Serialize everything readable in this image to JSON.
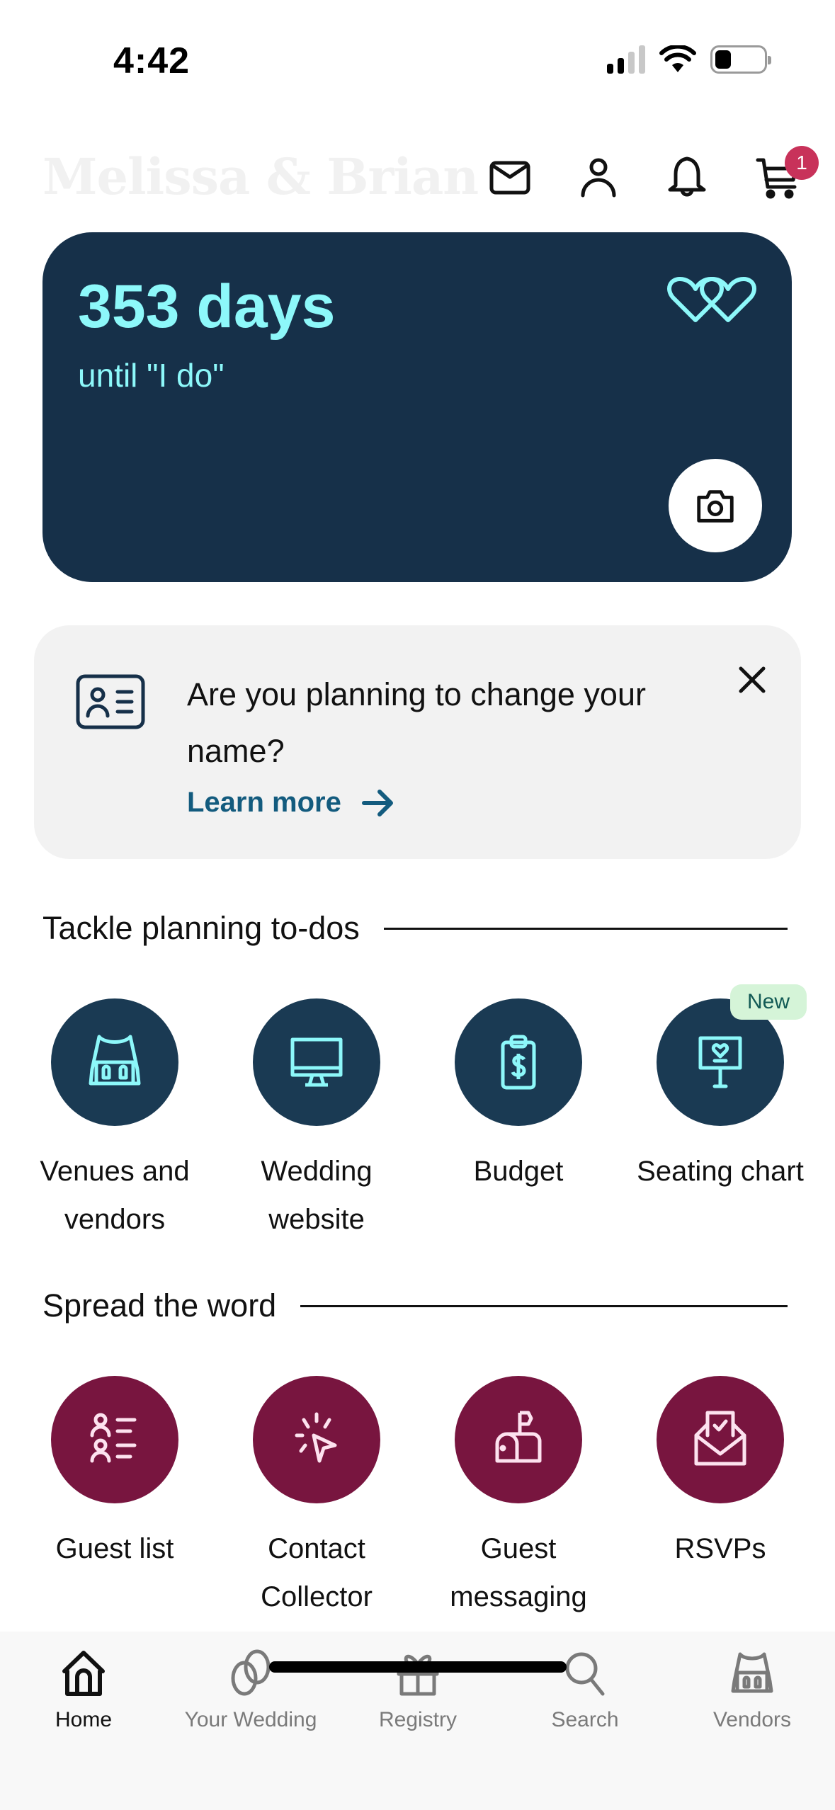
{
  "status_bar": {
    "time": "4:42",
    "signal_bars_active": 2,
    "signal_bars_total": 4,
    "battery_level": 0.25
  },
  "header": {
    "title": "Melissa & Brian",
    "icons": [
      "mail-icon",
      "profile-icon",
      "bell-icon",
      "cart-icon"
    ],
    "cart_badge_count": "1"
  },
  "countdown": {
    "days_text": "353 days",
    "subtitle": "until \"I do\"",
    "icon": "double-heart-icon",
    "camera_icon": "camera-icon"
  },
  "name_banner": {
    "icon": "id-card-icon",
    "text": "Are you planning to change your name?",
    "link_label": "Learn more",
    "link_icon": "arrow-right-icon",
    "close_icon": "close-icon"
  },
  "planning": {
    "heading": "Tackle planning to-dos",
    "items": [
      {
        "label": "Venues and vendors",
        "icon": "venue-icon"
      },
      {
        "label": "Wedding website",
        "icon": "monitor-icon"
      },
      {
        "label": "Budget",
        "icon": "budget-clipboard-icon"
      },
      {
        "label": "Seating chart",
        "icon": "seating-sign-icon",
        "badge": "New"
      }
    ]
  },
  "spread": {
    "heading": "Spread the word",
    "items": [
      {
        "label": "Guest list",
        "icon": "guest-list-icon"
      },
      {
        "label": "Contact Collector",
        "icon": "cursor-click-icon"
      },
      {
        "label": "Guest messaging",
        "icon": "mailbox-icon"
      },
      {
        "label": "RSVPs",
        "icon": "envelope-check-icon"
      }
    ]
  },
  "tab_bar": {
    "active": "Home",
    "tabs": [
      {
        "label": "Home",
        "icon": "home-icon"
      },
      {
        "label": "Your Wedding",
        "icon": "rings-icon"
      },
      {
        "label": "Registry",
        "icon": "gift-icon"
      },
      {
        "label": "Search",
        "icon": "search-icon"
      },
      {
        "label": "Vendors",
        "icon": "venue-icon"
      }
    ]
  },
  "colors": {
    "card_navy": "#163049",
    "accent_cyan": "#8df8fa",
    "maroon": "#78153f",
    "link_blue": "#135b7e",
    "badge_red": "#c8325a",
    "new_badge_bg": "#d5f4d8"
  }
}
